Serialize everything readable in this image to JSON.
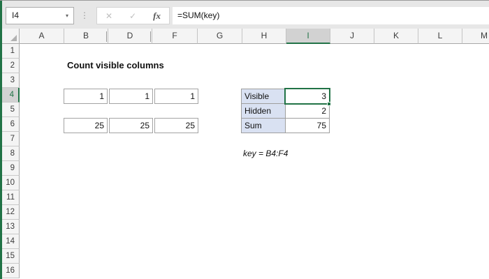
{
  "formula_bar": {
    "name_box_value": "I4",
    "dropdown_icon": "▾",
    "separator_dots": "⋮",
    "cancel_label": "✕",
    "enter_label": "✓",
    "fx_label": "fx",
    "formula": "=SUM(key)"
  },
  "sheet": {
    "title": "Count visible columns",
    "selected_cell": "I4",
    "column_headers": [
      "A",
      "B",
      "D",
      "F",
      "G",
      "H",
      "I",
      "J",
      "K",
      "L",
      "M"
    ],
    "row_headers": [
      "1",
      "2",
      "3",
      "4",
      "5",
      "6",
      "7",
      "8",
      "9",
      "10",
      "11",
      "12",
      "13",
      "14",
      "15",
      "16"
    ],
    "cells": {
      "B4": "1",
      "D4": "1",
      "F4": "1",
      "B6": "25",
      "D6": "25",
      "F6": "25",
      "H4": "Visible",
      "I4": "3",
      "H5": "Hidden",
      "I5": "2",
      "H6": "Sum",
      "I6": "75",
      "H8": "key = B4:F4"
    }
  },
  "colors": {
    "excel_green": "#217346",
    "label_fill": "#D9E1F2",
    "header_selected_bg": "#D2D2D2"
  }
}
